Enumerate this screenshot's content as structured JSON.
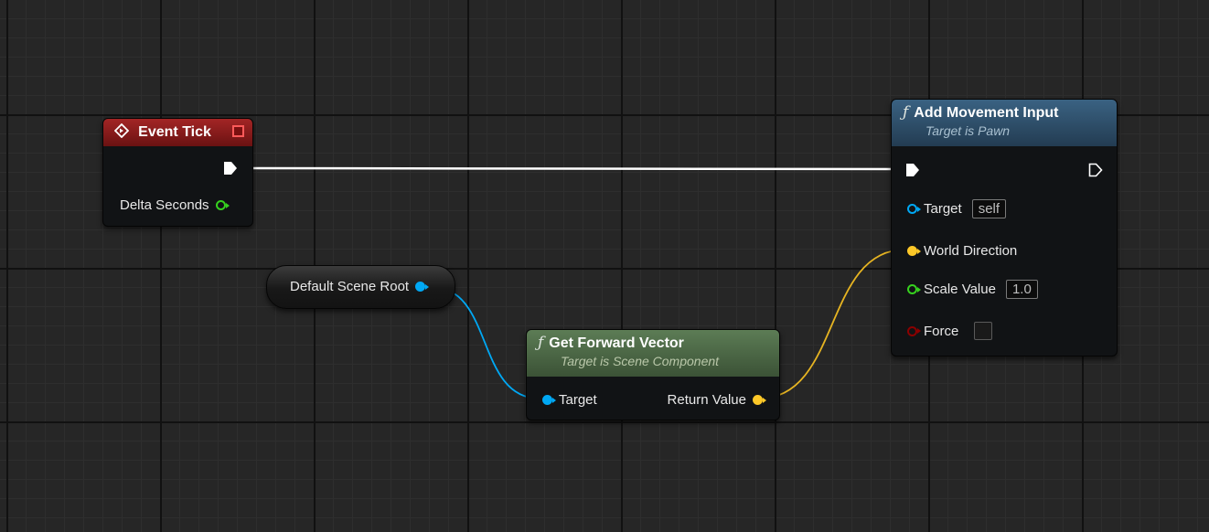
{
  "nodes": {
    "event_tick": {
      "title": "Event Tick",
      "delta_seconds_label": "Delta Seconds"
    },
    "default_scene_root": {
      "label": "Default Scene Root"
    },
    "get_forward_vector": {
      "title": "Get Forward Vector",
      "subtitle": "Target is Scene Component",
      "target_label": "Target",
      "return_label": "Return Value"
    },
    "add_movement_input": {
      "title": "Add Movement Input",
      "subtitle": "Target is Pawn",
      "target_label": "Target",
      "target_value": "self",
      "world_direction_label": "World Direction",
      "scale_value_label": "Scale Value",
      "scale_value": "1.0",
      "force_label": "Force"
    }
  },
  "colors": {
    "exec_wire": "#ffffff",
    "object_pin": "#00a8f4",
    "vector_pin": "#fdc828",
    "float_pin": "#36d11f",
    "bool_pin": "#8c0000",
    "event_header": "#a32525",
    "function_header": "#3a6282",
    "pure_header": "#5c7c55"
  },
  "icons": {
    "event": "event-diamond-icon",
    "function": "function-f-icon",
    "exec": "exec-arrow-icon"
  }
}
